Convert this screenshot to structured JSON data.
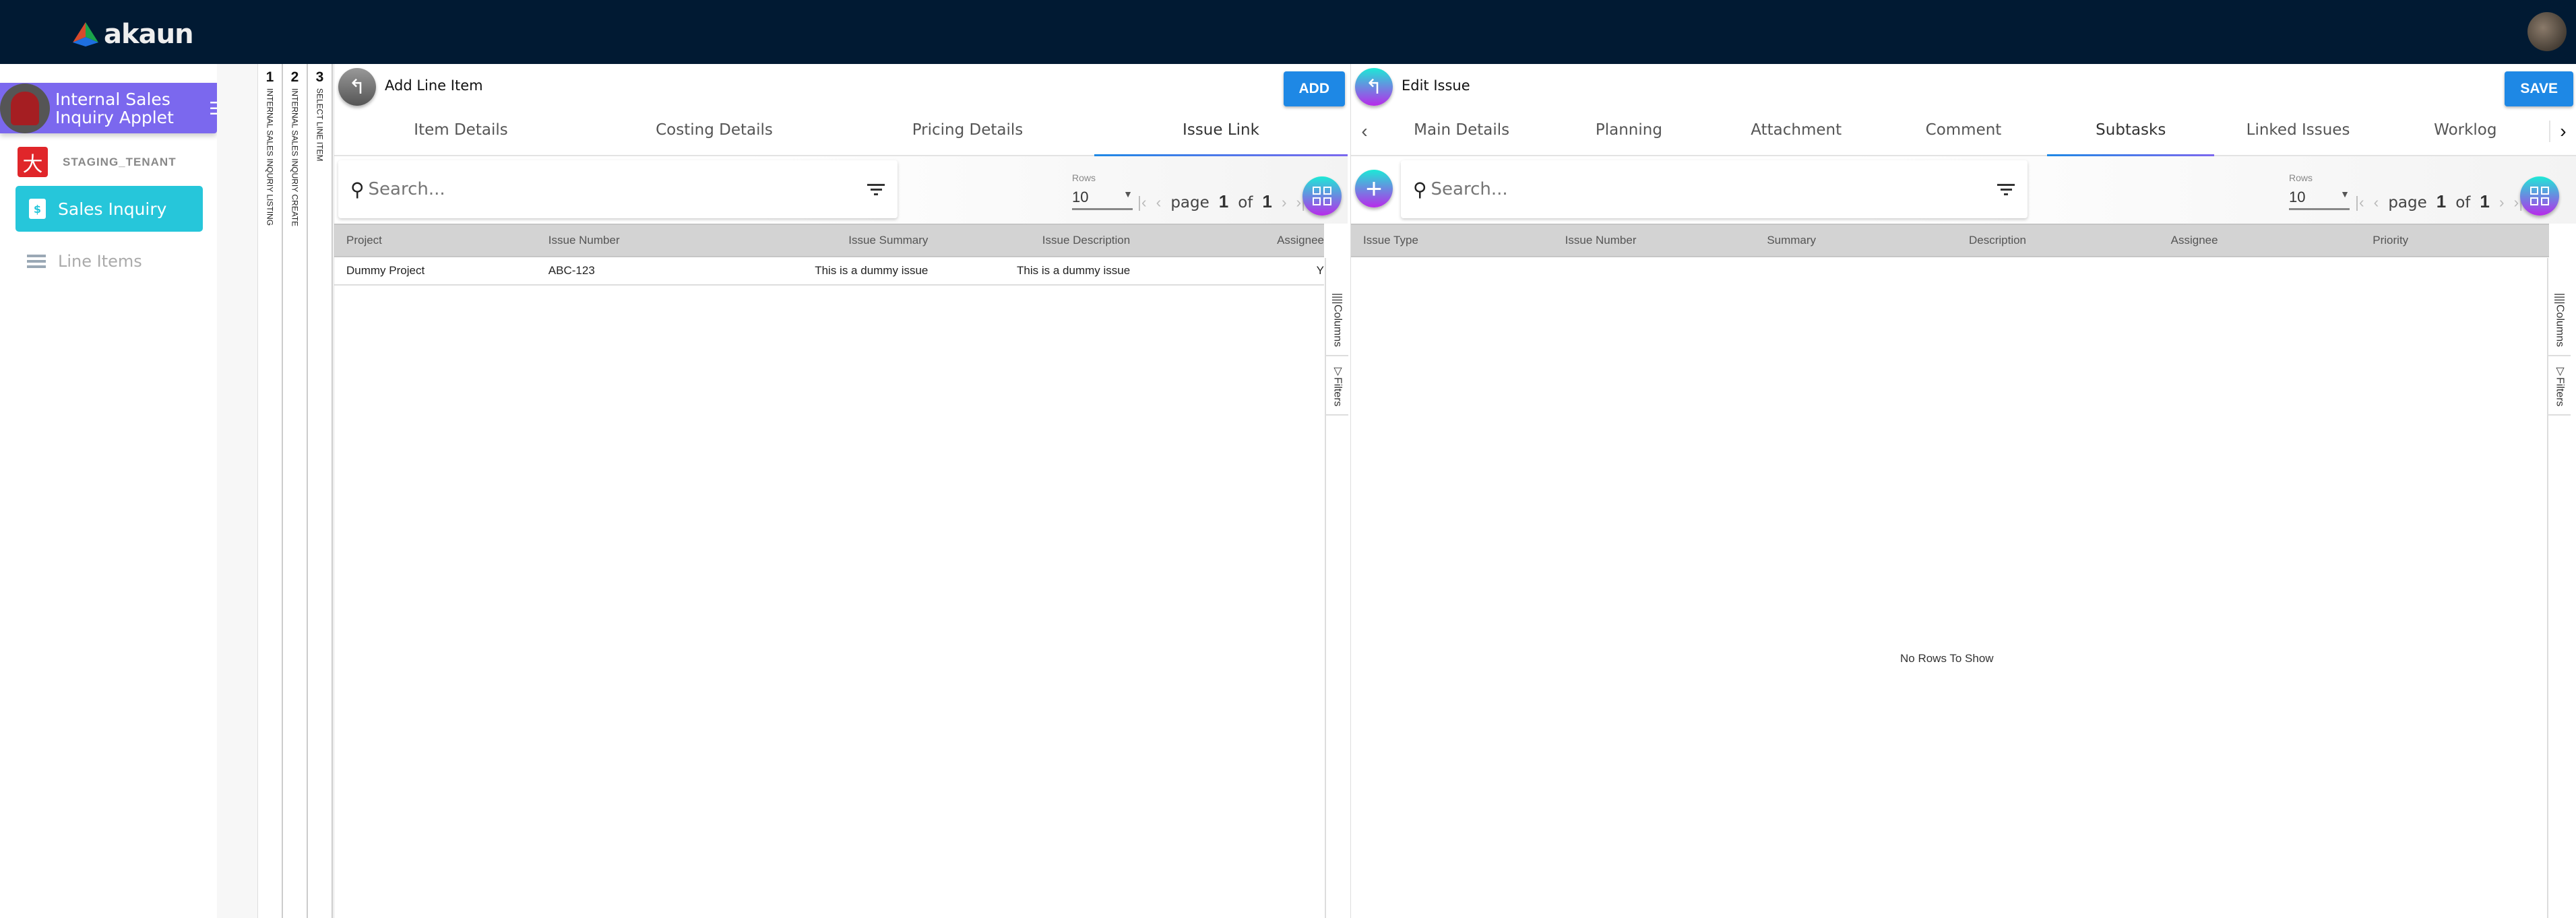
{
  "header": {
    "logo_text": "akaun"
  },
  "sidebar": {
    "applet_title": "Internal Sales Inquiry Applet",
    "tenant": "STAGING_TENANT",
    "items": [
      {
        "label": "Sales Inquiry",
        "icon": "dollar-document-icon",
        "active": true
      },
      {
        "label": "Line Items",
        "icon": "list-icon",
        "active": false
      }
    ]
  },
  "steps": [
    {
      "num": "1",
      "label": "INTERNAL SALES INQURIY LISTING"
    },
    {
      "num": "2",
      "label": "INTERNAL SALES INQURIY CREATE"
    },
    {
      "num": "3",
      "label": "SELECT LINE ITEM"
    }
  ],
  "left_panel": {
    "title": "Add Line Item",
    "action": "ADD",
    "tabs": [
      "Item Details",
      "Costing Details",
      "Pricing Details",
      "Issue Link"
    ],
    "active_tab": "Issue Link",
    "search_placeholder": "Search...",
    "rows_label": "Rows",
    "rows_value": "10",
    "page_word": "page",
    "page": "1",
    "of_word": "of",
    "total_pages": "1",
    "columns": [
      "Project",
      "Issue Number",
      "Issue Summary",
      "Issue Description",
      "Assignee"
    ],
    "rows": [
      [
        "Dummy Project",
        "ABC-123",
        "This is a dummy issue",
        "This is a dummy issue",
        "Y"
      ]
    ],
    "side_buttons": [
      "Columns",
      "Filters"
    ]
  },
  "right_panel": {
    "title": "Edit Issue",
    "action": "SAVE",
    "tabs": [
      "Main Details",
      "Planning",
      "Attachment",
      "Comment",
      "Subtasks",
      "Linked Issues",
      "Worklog"
    ],
    "active_tab": "Subtasks",
    "search_placeholder": "Search...",
    "rows_label": "Rows",
    "rows_value": "10",
    "page_word": "page",
    "page": "1",
    "of_word": "of",
    "total_pages": "1",
    "columns": [
      "Issue Type",
      "Issue Number",
      "Summary",
      "Description",
      "Assignee",
      "Priority"
    ],
    "empty_message": "No Rows To Show",
    "side_buttons": [
      "Columns",
      "Filters"
    ]
  },
  "colors": {
    "header": "#011a33",
    "applet": "#7b68ee",
    "active_nav": "#26c6da",
    "primary_button": "#1e88e5",
    "highlight": "#ff0000"
  }
}
